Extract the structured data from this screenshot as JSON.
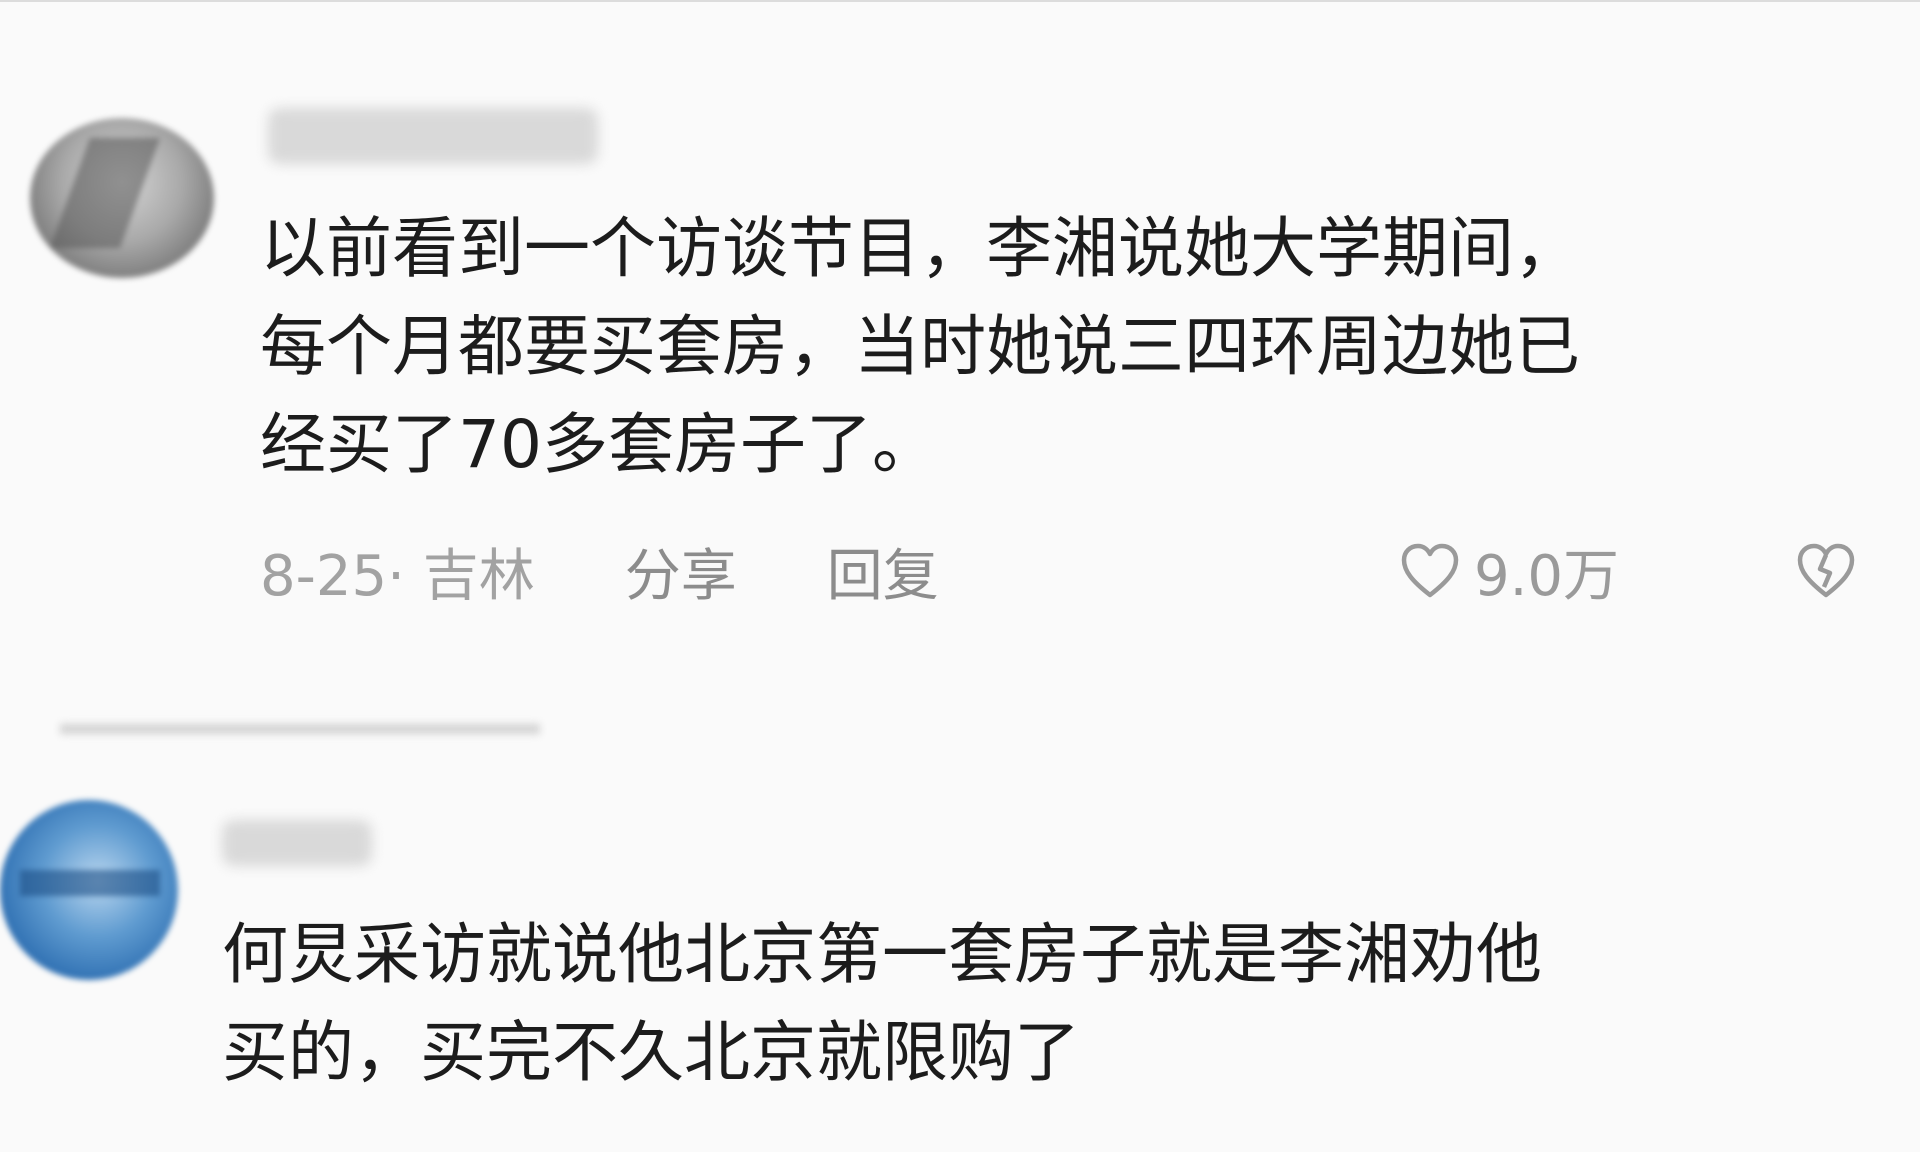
{
  "comments": [
    {
      "text": "以前看到一个访谈节目，李湘说她大学期间，\n每个月都要买套房，当时她说三四环周边她已\n经买了70多套房子了。",
      "date_location": "8-25· 吉林",
      "share_label": "分享",
      "reply_label": "回复",
      "like_count": "9.0万",
      "like_icon": "heart-outline-icon",
      "dislike_icon": "broken-heart-icon"
    },
    {
      "text": "何炅采访就说他北京第一套房子就是李湘劝他\n买的，买完不久北京就限购了"
    }
  ],
  "colors": {
    "text": "#1c1c1c",
    "meta": "#a2a2a2",
    "background": "#fafafa"
  }
}
